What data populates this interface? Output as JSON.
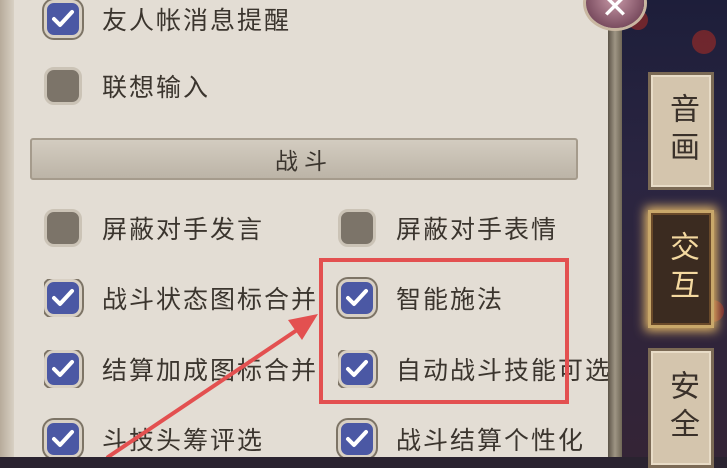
{
  "close_button": {
    "glyph": "✕"
  },
  "tabs": [
    {
      "label": "音画",
      "active": false
    },
    {
      "label": "交互",
      "active": true
    },
    {
      "label": "安全",
      "active": false
    }
  ],
  "section": {
    "title": "战斗"
  },
  "settings": {
    "friend_message_alert": {
      "label": "友人帐消息提醒",
      "checked": true
    },
    "predictive_input": {
      "label": "联想输入",
      "checked": false
    },
    "block_opponent_chat": {
      "label": "屏蔽对手发言",
      "checked": false
    },
    "block_opponent_emote": {
      "label": "屏蔽对手表情",
      "checked": false
    },
    "merge_status_icons": {
      "label": "战斗状态图标合并",
      "checked": true
    },
    "smart_cast": {
      "label": "智能施法",
      "checked": true
    },
    "merge_bonus_icons": {
      "label": "结算加成图标合并",
      "checked": true
    },
    "auto_battle_skill_select": {
      "label": "自动战斗技能可选",
      "checked": true
    },
    "tech_header_vote": {
      "label": "斗技头筹评选",
      "checked": true
    },
    "battle_result_personalize": {
      "label": "战斗结算个性化",
      "checked": true
    }
  },
  "colors": {
    "checkbox_on": "#4b58a4",
    "checkbox_off": "#7c7469",
    "highlight_box": "#e35050",
    "arrow": "#e35050"
  }
}
